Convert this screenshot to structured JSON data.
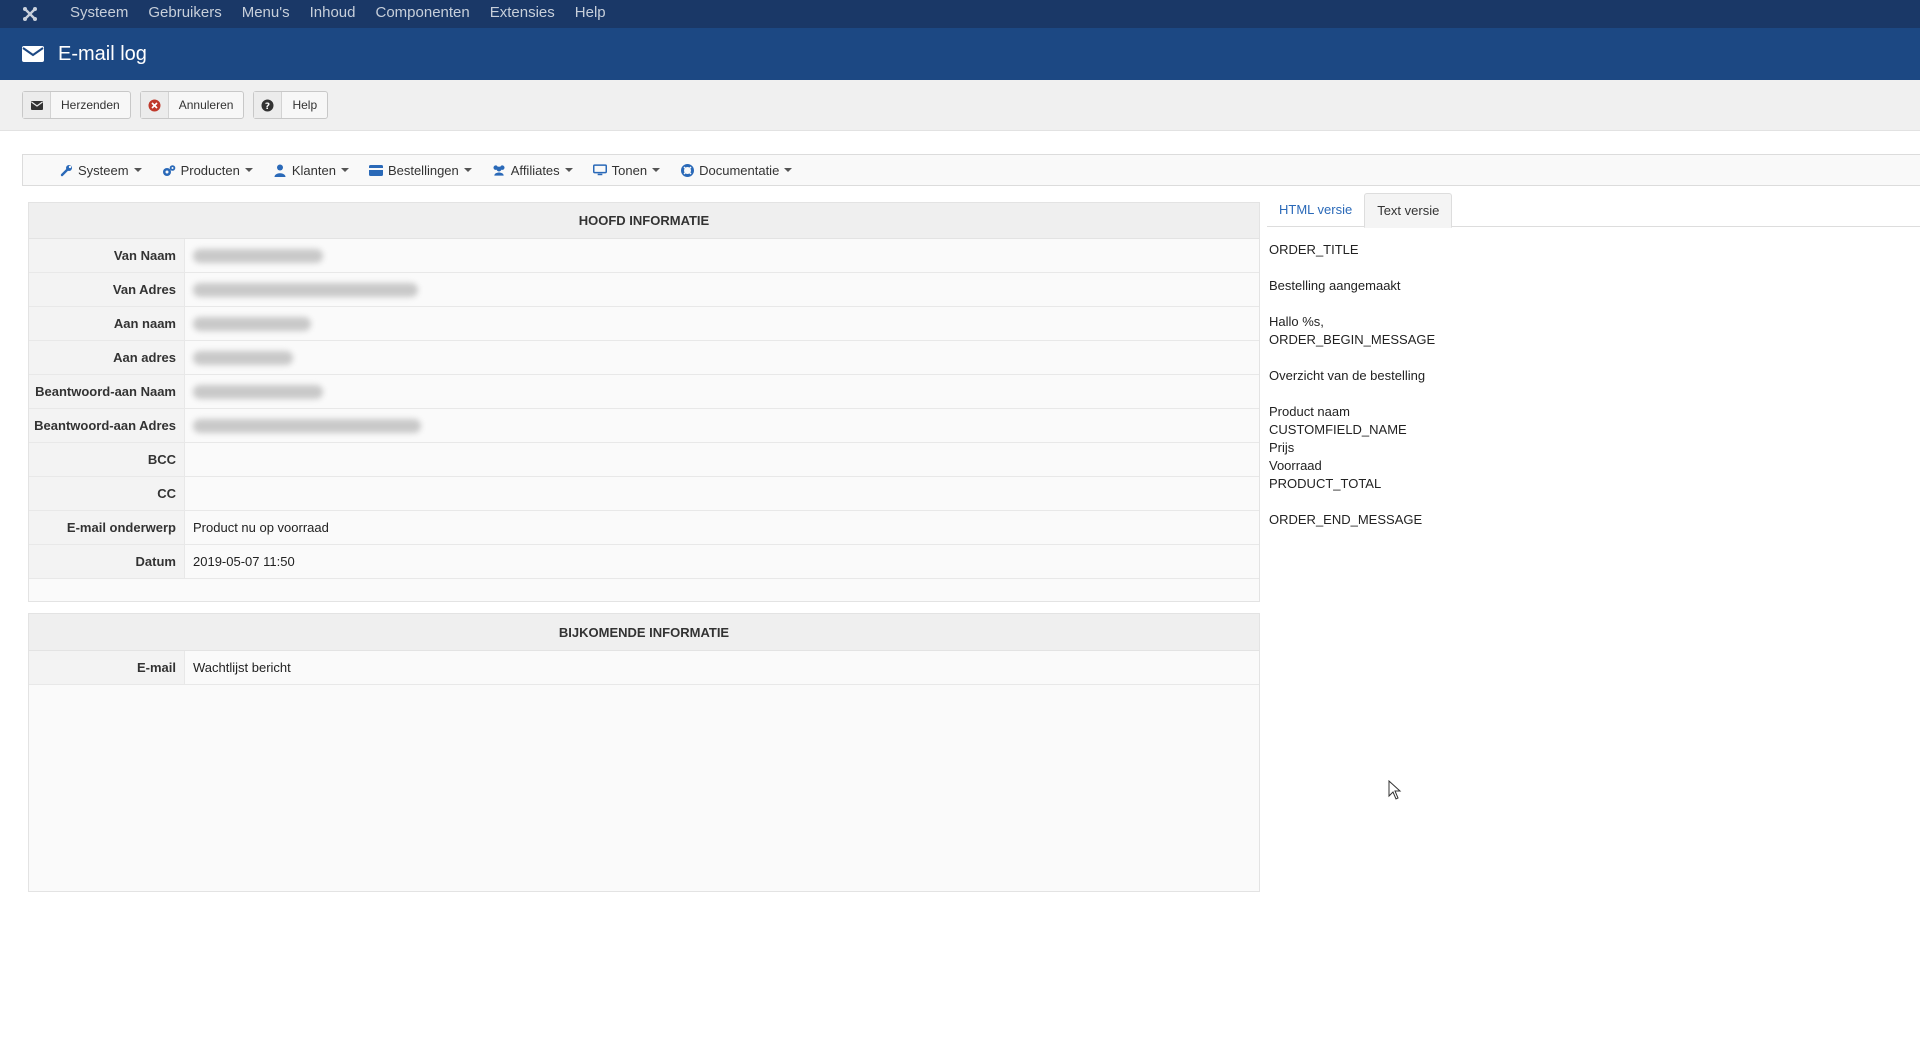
{
  "topbar": {
    "menu": [
      "Systeem",
      "Gebruikers",
      "Menu's",
      "Inhoud",
      "Componenten",
      "Extensies",
      "Help"
    ]
  },
  "page": {
    "title": "E-mail log"
  },
  "toolbar": {
    "resend": "Herzenden",
    "cancel": "Annuleren",
    "help": "Help"
  },
  "subnav": {
    "items": [
      "Systeem",
      "Producten",
      "Klanten",
      "Bestellingen",
      "Affiliates",
      "Tonen",
      "Documentatie"
    ]
  },
  "main_info": {
    "heading": "HOOFD INFORMATIE",
    "rows": [
      {
        "label": "Van Naam",
        "value": ""
      },
      {
        "label": "Van Adres",
        "value": ""
      },
      {
        "label": "Aan naam",
        "value": ""
      },
      {
        "label": "Aan adres",
        "value": ""
      },
      {
        "label": "Beantwoord-aan Naam",
        "value": ""
      },
      {
        "label": "Beantwoord-aan Adres",
        "value": ""
      },
      {
        "label": "BCC",
        "value": ""
      },
      {
        "label": "CC",
        "value": ""
      },
      {
        "label": "E-mail onderwerp",
        "value": "Product nu op voorraad"
      },
      {
        "label": "Datum",
        "value": "2019-05-07 11:50"
      }
    ]
  },
  "extra_info": {
    "heading": "BIJKOMENDE INFORMATIE",
    "rows": [
      {
        "label": "E-mail",
        "value": "Wachtlijst bericht"
      }
    ]
  },
  "tabs": {
    "html": "HTML versie",
    "text": "Text versie"
  },
  "text_version": {
    "lines": [
      "ORDER_TITLE",
      "",
      "Bestelling aangemaakt",
      "",
      "Hallo %s,",
      "ORDER_BEGIN_MESSAGE",
      "",
      "Overzicht van de bestelling",
      "",
      "Product naam",
      "CUSTOMFIELD_NAME",
      "Prijs",
      "Voorraad",
      "PRODUCT_TOTAL",
      "",
      "ORDER_END_MESSAGE"
    ]
  }
}
